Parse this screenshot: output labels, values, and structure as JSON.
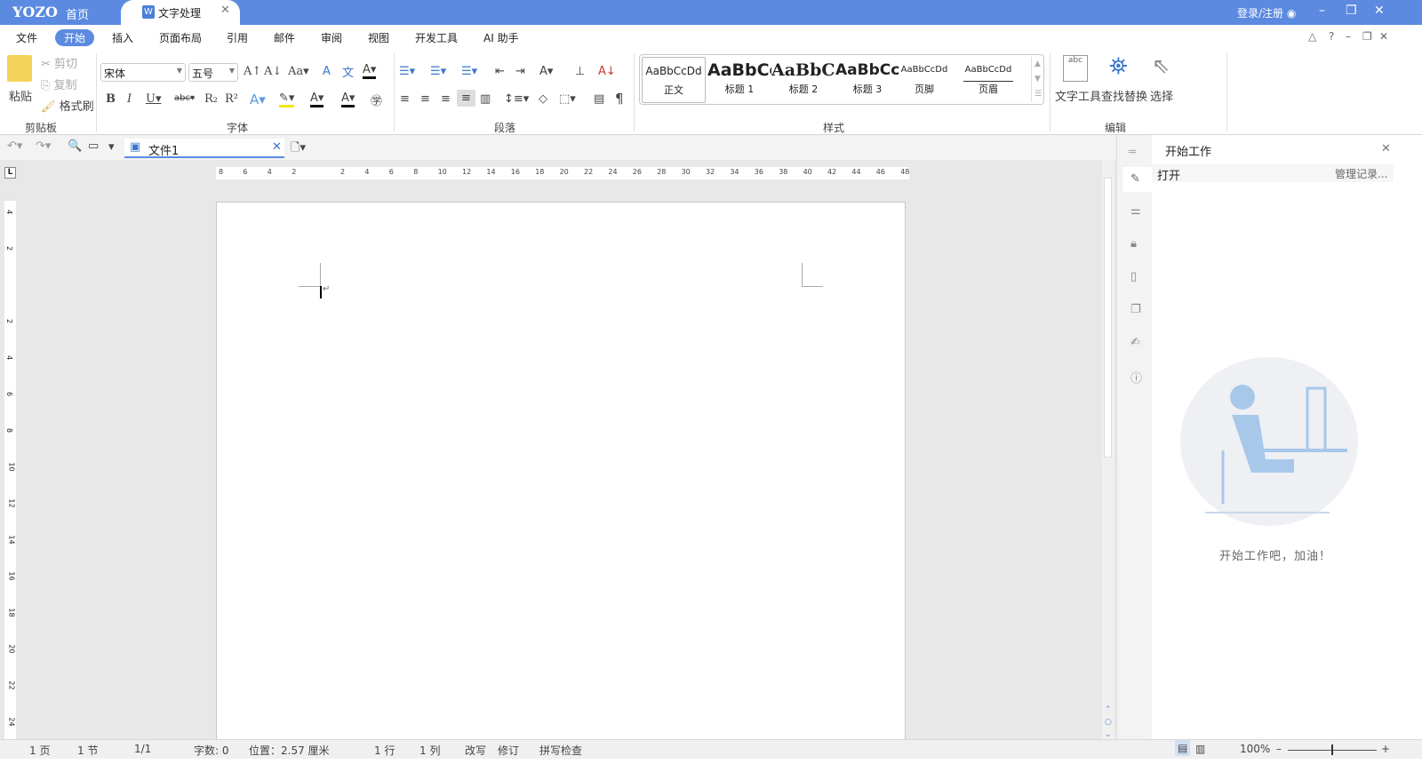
{
  "titlebar": {
    "logo": "YOZO",
    "home": "首页",
    "tab": "文字处理",
    "tab_icon": "W",
    "login": "登录/注册"
  },
  "menu": [
    "文件",
    "开始",
    "插入",
    "页面布局",
    "引用",
    "邮件",
    "审阅",
    "视图",
    "开发工具",
    "AI 助手"
  ],
  "clipboard": {
    "paste": "粘贴",
    "cut": "剪切",
    "copy": "复制",
    "format_painter": "格式刷",
    "group": "剪贴板"
  },
  "font": {
    "name": "宋体",
    "size": "五号",
    "group": "字体"
  },
  "paragraph": {
    "group": "段落"
  },
  "styles": {
    "group": "样式",
    "items": [
      {
        "preview": "AaBbCcDd",
        "name": "正文"
      },
      {
        "preview": "AaBbCc",
        "name": "标题 1"
      },
      {
        "preview": "AaBbC(",
        "name": "标题 2"
      },
      {
        "preview": "AaBbCcI",
        "name": "标题 3"
      },
      {
        "preview": "AaBbCcDd",
        "name": "页脚"
      },
      {
        "preview": "AaBbCcDd",
        "name": "页眉"
      }
    ]
  },
  "edit": {
    "group": "编辑",
    "text_tools": "文字工具",
    "find_replace": "查找替换",
    "select": "选择"
  },
  "document": {
    "tab": "文件1"
  },
  "ruler": {
    "h_ticks": [
      "8",
      "6",
      "4",
      "2",
      "",
      "2",
      "4",
      "6",
      "8",
      "10",
      "12",
      "14",
      "16",
      "18",
      "20",
      "22",
      "24",
      "26",
      "28",
      "30",
      "32",
      "34",
      "36",
      "38",
      "40",
      "42",
      "44",
      "46",
      "48"
    ],
    "v_ticks": [
      "4",
      "2",
      "",
      "2",
      "4",
      "6",
      "8",
      "10",
      "12",
      "14",
      "16",
      "18",
      "20",
      "22",
      "24"
    ]
  },
  "panel": {
    "title": "开始工作",
    "open": "打开",
    "manage": "管理记录...",
    "message": "开始工作吧，加油！"
  },
  "status": {
    "page": "1 页",
    "section": "1 节",
    "pages": "1/1",
    "words": "字数: 0",
    "position": "位置：2.57 厘米",
    "line": "1 行",
    "col": "1 列",
    "overtype": "改写",
    "revise": "修订",
    "spell": "拼写检查",
    "zoom": "100%"
  },
  "colors": {
    "accent": "#5b8ae0"
  }
}
